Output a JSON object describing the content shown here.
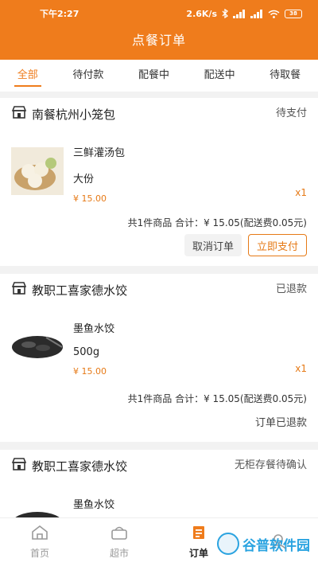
{
  "status_bar": {
    "time": "下午2:27",
    "speed": "2.6K/s",
    "battery": "38"
  },
  "header": {
    "title": "点餐订单"
  },
  "tabs": [
    "全部",
    "待付款",
    "配餐中",
    "配送中",
    "待取餐"
  ],
  "active_tab": "全部",
  "orders": [
    {
      "store": "南餐杭州小笼包",
      "status": "待支付",
      "item": {
        "name": "三鲜灌汤包",
        "spec": "大份",
        "price": "¥ 15.00",
        "qty": "x1"
      },
      "total": "共1件商品 合计：¥ 15.05(配送费0.05元)",
      "cancel_label": "取消订单",
      "pay_label": "立即支付"
    },
    {
      "store": "教职工喜家德水饺",
      "status": "已退款",
      "item": {
        "name": "墨鱼水饺",
        "spec": "500g",
        "price": "¥ 15.00",
        "qty": "x1"
      },
      "total": "共1件商品 合计：¥ 15.05(配送费0.05元)",
      "refund_text": "订单已退款"
    },
    {
      "store": "教职工喜家德水饺",
      "status": "无柜存餐待确认",
      "item": {
        "name": "墨鱼水饺"
      }
    }
  ],
  "bottom_nav": [
    {
      "label": "首页",
      "icon": "home-icon"
    },
    {
      "label": "超市",
      "icon": "basket-icon"
    },
    {
      "label": "订单",
      "icon": "order-icon"
    },
    {
      "label": "我的",
      "icon": "profile-icon"
    }
  ],
  "watermark": "谷普软件园",
  "colors": {
    "brand": "#ef7c1c",
    "price": "#e67a17"
  }
}
